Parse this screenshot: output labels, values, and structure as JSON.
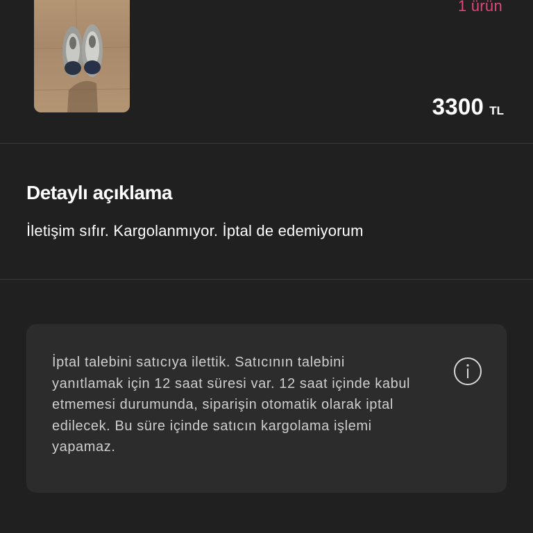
{
  "product": {
    "item_count": "1 ürün",
    "price_amount": "3300",
    "price_currency": "TL",
    "thumbnail_icon": "sneakers-photo"
  },
  "description": {
    "title": "Detaylı açıklama",
    "text": "İletişim sıfır. Kargolanmıyor. İptal de edemiyorum"
  },
  "info_card": {
    "text": "İptal talebini satıcıya ilettik. Satıcının talebini yanıtlamak için 12 saat süresi var. 12 saat içinde kabul etmemesi durumunda, siparişin otomatik olarak iptal edilecek. Bu süre içinde satıcın kargolama işlemi yapamaz.",
    "icon": "info-circle-icon"
  },
  "colors": {
    "background": "#202020",
    "card": "#2c2c2c",
    "accent": "#e0457b",
    "text": "#ffffff",
    "muted_text": "#cfcfcf"
  }
}
